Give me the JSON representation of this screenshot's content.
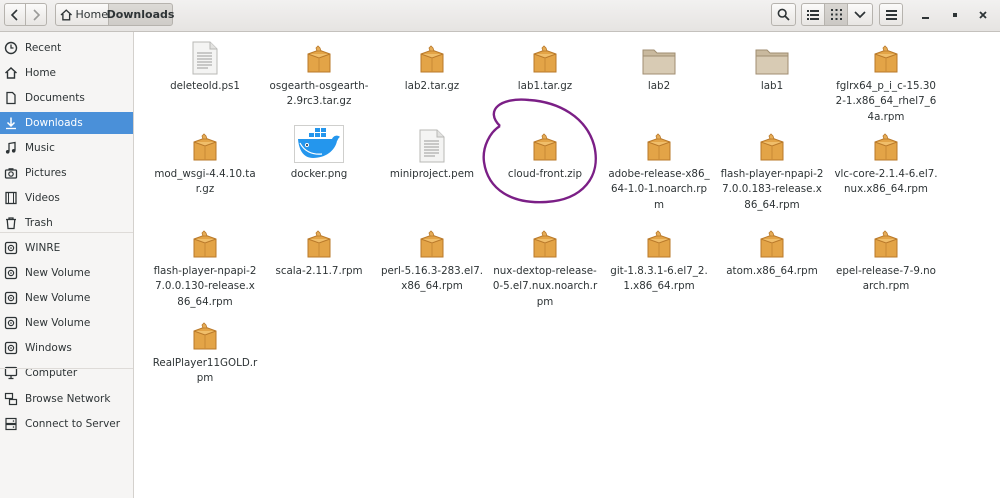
{
  "header": {
    "breadcrumb": [
      {
        "label": "Home",
        "icon": "home-icon"
      },
      {
        "label": "Downloads"
      }
    ]
  },
  "sidebar": {
    "items": [
      {
        "label": "Recent",
        "icon": "clock-icon"
      },
      {
        "label": "Home",
        "icon": "home-icon"
      },
      {
        "label": "Documents",
        "icon": "document-icon"
      },
      {
        "label": "Downloads",
        "icon": "download-icon",
        "selected": true
      },
      {
        "label": "Music",
        "icon": "music-icon"
      },
      {
        "label": "Pictures",
        "icon": "camera-icon"
      },
      {
        "label": "Videos",
        "icon": "film-icon"
      },
      {
        "label": "Trash",
        "icon": "trash-icon"
      },
      {
        "label": "WINRE",
        "icon": "drive-icon"
      },
      {
        "label": "New Volume",
        "icon": "drive-icon"
      },
      {
        "label": "New Volume",
        "icon": "drive-icon"
      },
      {
        "label": "New Volume",
        "icon": "drive-icon"
      },
      {
        "label": "Windows",
        "icon": "drive-icon"
      },
      {
        "label": "Computer",
        "icon": "computer-icon"
      },
      {
        "label": "Browse Network",
        "icon": "network-icon"
      },
      {
        "label": "Connect to Server",
        "icon": "server-icon"
      }
    ]
  },
  "files": [
    {
      "name": "deleteold.ps1",
      "type": "text"
    },
    {
      "name": "osgearth-osgearth-2.9rc3.tar.gz",
      "type": "archive"
    },
    {
      "name": "lab2.tar.gz",
      "type": "archive"
    },
    {
      "name": "lab1.tar.gz",
      "type": "archive"
    },
    {
      "name": "lab2",
      "type": "folder"
    },
    {
      "name": "lab1",
      "type": "folder"
    },
    {
      "name": "fglrx64_p_i_c-15.302-1.x86_64_rhel7_64a.rpm",
      "type": "archive"
    },
    {
      "name": "mod_wsgi-4.4.10.tar.gz",
      "type": "archive"
    },
    {
      "name": "docker.png",
      "type": "image"
    },
    {
      "name": "miniproject.pem",
      "type": "text"
    },
    {
      "name": "cloud-front.zip",
      "type": "archive"
    },
    {
      "name": "adobe-release-x86_64-1.0-1.noarch.rpm",
      "type": "archive"
    },
    {
      "name": "flash-player-npapi-27.0.0.183-release.x86_64.rpm",
      "type": "archive"
    },
    {
      "name": "vlc-core-2.1.4-6.el7.nux.x86_64.rpm",
      "type": "archive"
    },
    {
      "name": "flash-player-npapi-27.0.0.130-release.x86_64.rpm",
      "type": "archive"
    },
    {
      "name": "scala-2.11.7.rpm",
      "type": "archive"
    },
    {
      "name": "perl-5.16.3-283.el7.x86_64.rpm",
      "type": "archive"
    },
    {
      "name": "nux-dextop-release-0-5.el7.nux.noarch.rpm",
      "type": "archive"
    },
    {
      "name": "git-1.8.3.1-6.el7_2.1.x86_64.rpm",
      "type": "archive"
    },
    {
      "name": "atom.x86_64.rpm",
      "type": "archive"
    },
    {
      "name": "epel-release-7-9.noarch.rpm",
      "type": "archive"
    },
    {
      "name": "RealPlayer11GOLD.rpm",
      "type": "archive"
    }
  ],
  "colors": {
    "selection": "#4a90d9",
    "annotation_circle": "#7b1f86",
    "archive_icon": "#e0a24a",
    "folder_icon": "#c9b99e"
  }
}
